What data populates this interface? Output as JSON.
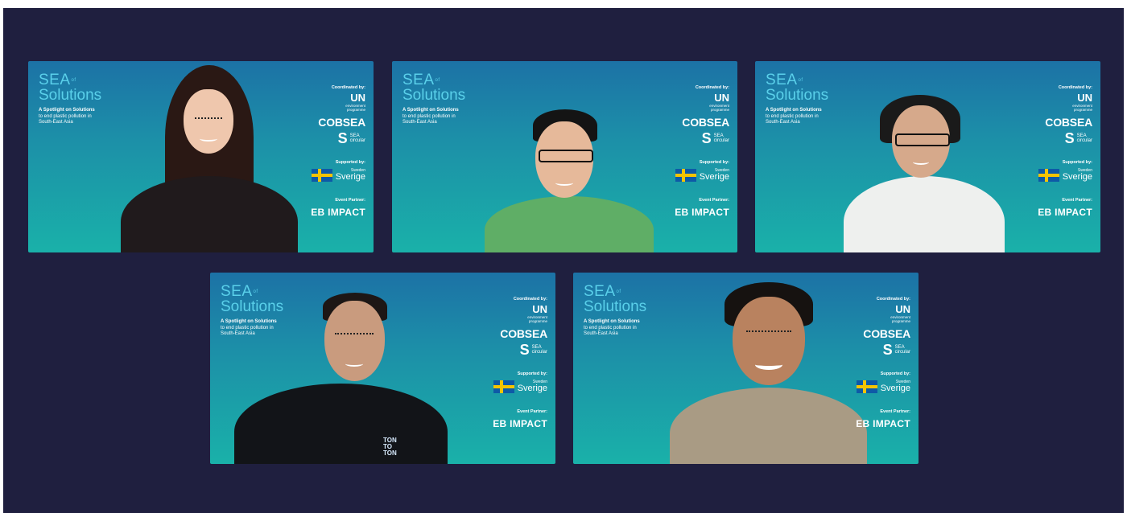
{
  "tiles": [
    {
      "brand_sea": "SEA",
      "brand_of": "of",
      "brand_solutions": "Solutions",
      "tagline_1": "A Spotlight on Solutions",
      "tagline_2": "to end plastic pollution in",
      "tagline_3": "South-East Asia",
      "coordinated_label": "Coordinated by:",
      "un": "UN",
      "un_sub_1": "environment",
      "un_sub_2": "programme",
      "cobsea": "COBSEA",
      "seacircular_1": "SEA",
      "seacircular_2": "circular",
      "supported_label": "Supported by:",
      "sweden": "Sweden",
      "sverige": "Sverige",
      "event_label": "Event Partner:",
      "eb_impact": "EB IMPACT"
    },
    {
      "brand_sea": "SEA",
      "brand_of": "of",
      "brand_solutions": "Solutions",
      "tagline_1": "A Spotlight on Solutions",
      "tagline_2": "to end plastic pollution in",
      "tagline_3": "South-East Asia",
      "coordinated_label": "Coordinated by:",
      "un": "UN",
      "un_sub_1": "environment",
      "un_sub_2": "programme",
      "cobsea": "COBSEA",
      "seacircular_1": "SEA",
      "seacircular_2": "circular",
      "supported_label": "Supported by:",
      "sweden": "Sweden",
      "sverige": "Sverige",
      "event_label": "Event Partner:",
      "eb_impact": "EB IMPACT"
    },
    {
      "brand_sea": "SEA",
      "brand_of": "of",
      "brand_solutions": "Solutions",
      "tagline_1": "A Spotlight on Solutions",
      "tagline_2": "to end plastic pollution in",
      "tagline_3": "South-East Asia",
      "coordinated_label": "Coordinated by:",
      "un": "UN",
      "un_sub_1": "environment",
      "un_sub_2": "programme",
      "cobsea": "COBSEA",
      "seacircular_1": "SEA",
      "seacircular_2": "circular",
      "supported_label": "Supported by:",
      "sweden": "Sweden",
      "sverige": "Sverige",
      "event_label": "Event Partner:",
      "eb_impact": "EB IMPACT"
    },
    {
      "brand_sea": "SEA",
      "brand_of": "of",
      "brand_solutions": "Solutions",
      "tagline_1": "A Spotlight on Solutions",
      "tagline_2": "to end plastic pollution in",
      "tagline_3": "South-East Asia",
      "coordinated_label": "Coordinated by:",
      "un": "UN",
      "un_sub_1": "environment",
      "un_sub_2": "programme",
      "cobsea": "COBSEA",
      "seacircular_1": "SEA",
      "seacircular_2": "circular",
      "supported_label": "Supported by:",
      "sweden": "Sweden",
      "sverige": "Sverige",
      "event_label": "Event Partner:",
      "eb_impact": "EB IMPACT",
      "shirt_logo_1": "TON",
      "shirt_logo_2": "TO",
      "shirt_logo_3": "TON"
    },
    {
      "brand_sea": "SEA",
      "brand_of": "of",
      "brand_solutions": "Solutions",
      "tagline_1": "A Spotlight on Solutions",
      "tagline_2": "to end plastic pollution in",
      "tagline_3": "South-East Asia",
      "coordinated_label": "Coordinated by:",
      "un": "UN",
      "un_sub_1": "environment",
      "un_sub_2": "programme",
      "cobsea": "COBSEA",
      "seacircular_1": "SEA",
      "seacircular_2": "circular",
      "supported_label": "Supported by:",
      "sweden": "Sweden",
      "sverige": "Sverige",
      "event_label": "Event Partner:",
      "eb_impact": "EB IMPACT"
    }
  ],
  "colors": {
    "background": "#1f1f3f",
    "tile_top": "#1c72a6",
    "tile_bottom": "#1ab1a9",
    "brand_text": "#5ad0ea",
    "flag_blue": "#0e5aa7",
    "flag_yellow": "#f5c400"
  }
}
